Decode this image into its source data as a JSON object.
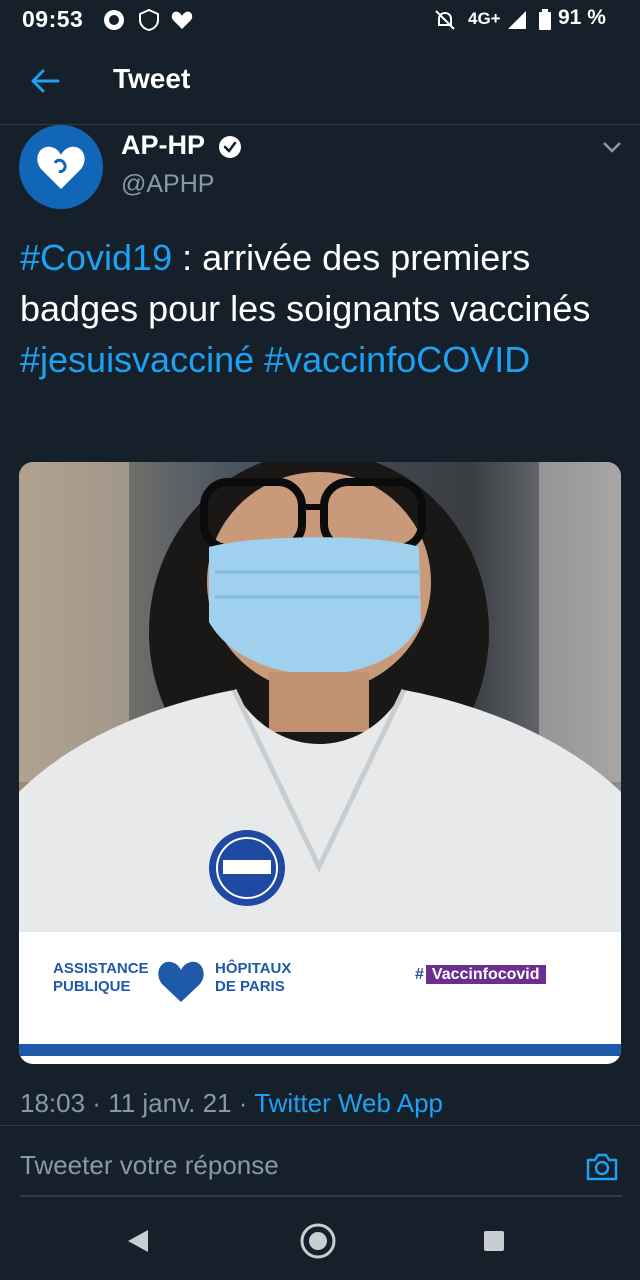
{
  "status_bar": {
    "time": "09:53",
    "network": "4G+",
    "battery": "91 %"
  },
  "header": {
    "title": "Tweet"
  },
  "tweet": {
    "author_name": "AP-HP",
    "handle": "@APHP",
    "text_parts": [
      {
        "text": "#Covid19",
        "type": "hashtag"
      },
      {
        "text": " : arrivée des premiers badges pour les soignants vaccinés ",
        "type": "text"
      },
      {
        "text": "#jesuisvacciné",
        "type": "hashtag"
      },
      {
        "text": " ",
        "type": "text"
      },
      {
        "text": "#vaccinfoCOVID",
        "type": "hashtag"
      }
    ],
    "image_brand": {
      "left_line1": "ASSISTANCE",
      "left_line2": "PUBLIQUE",
      "right_line1": "HÔPITAUX",
      "right_line2": "DE  PARIS",
      "hashtag_prefix": "#",
      "hashtag_label": "Vaccinfocovid"
    },
    "time": "18:03",
    "date": "11 janv. 21",
    "source": "Twitter Web App"
  },
  "reply": {
    "placeholder": "Tweeter votre réponse"
  },
  "colors": {
    "background": "#15202b",
    "accent": "#1da1f2",
    "muted": "#8899a6"
  },
  "icons": [
    "back-arrow-icon",
    "verified-badge-icon",
    "chevron-down-icon",
    "camera-icon",
    "nav-back-icon",
    "nav-home-icon",
    "nav-recents-icon"
  ]
}
